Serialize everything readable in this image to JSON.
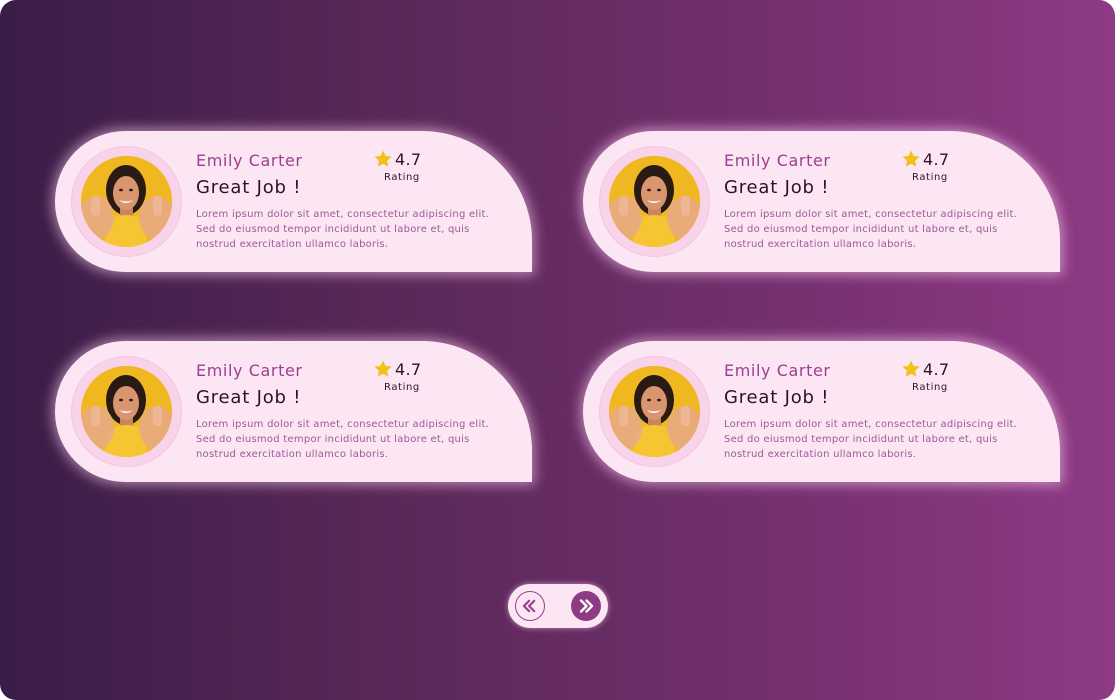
{
  "cards": [
    {
      "name": "Emily Carter",
      "title": "Great Job !",
      "body": "Lorem ipsum dolor sit amet, consectetur adipiscing elit. Sed do eiusmod tempor incididunt ut labore et, quis nostrud exercitation ullamco laboris.",
      "rating_value": "4.7",
      "rating_label": "Rating"
    },
    {
      "name": "Emily Carter",
      "title": "Great Job !",
      "body": "Lorem ipsum dolor sit amet, consectetur adipiscing elit. Sed do eiusmod tempor incididunt ut labore et, quis nostrud exercitation ullamco laboris.",
      "rating_value": "4.7",
      "rating_label": "Rating"
    },
    {
      "name": "Emily Carter",
      "title": "Great Job !",
      "body": "Lorem ipsum dolor sit amet, consectetur adipiscing elit. Sed do eiusmod tempor incididunt ut labore et, quis nostrud exercitation ullamco laboris.",
      "rating_value": "4.7",
      "rating_label": "Rating"
    },
    {
      "name": "Emily Carter",
      "title": "Great Job !",
      "body": "Lorem ipsum dolor sit amet, consectetur adipiscing elit. Sed do eiusmod tempor incididunt ut labore et, quis nostrud exercitation ullamco laboris.",
      "rating_value": "4.7",
      "rating_label": "Rating"
    }
  ],
  "icons": {
    "rating": "star-icon",
    "prev": "double-chevron-left-icon",
    "next": "double-chevron-right-icon"
  },
  "colors": {
    "background_start": "#3a1d47",
    "background_end": "#8e3a85",
    "card": "#fce6f3",
    "accent": "#9a3f93",
    "star": "#f2c21b",
    "text_dark": "#2d1230"
  }
}
